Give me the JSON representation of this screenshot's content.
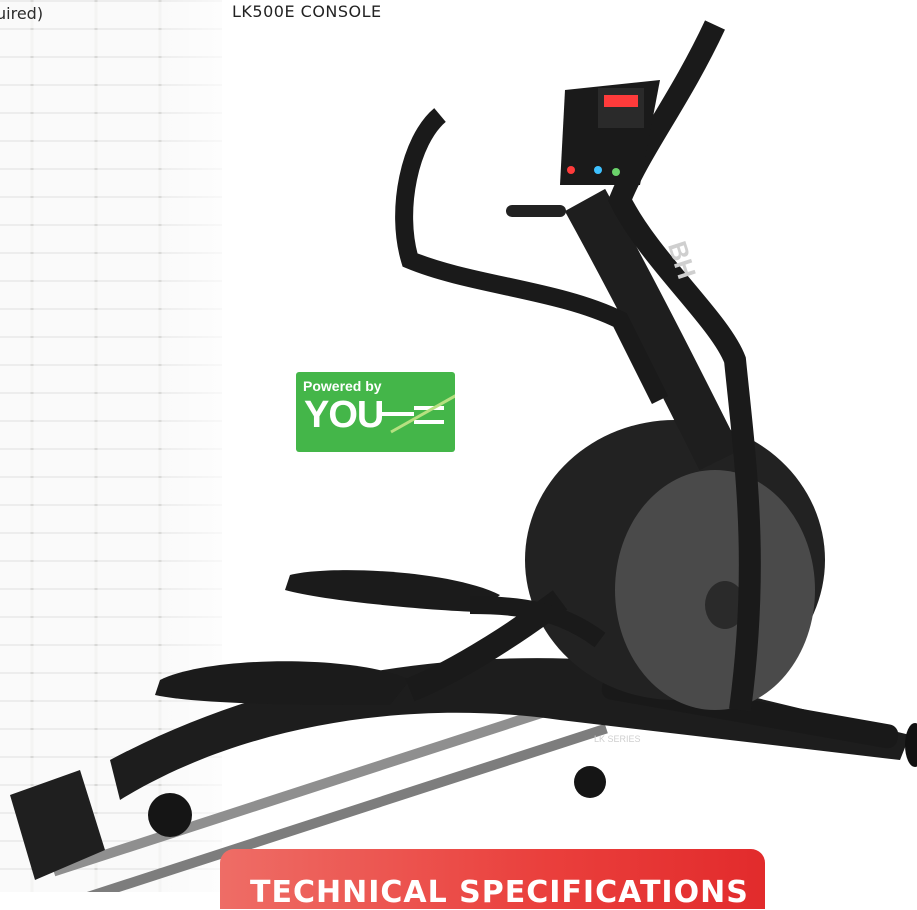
{
  "left_text": "uired)",
  "console_title": "LK500E CONSOLE",
  "badge": {
    "line1": "Powered by",
    "line2": "YOU"
  },
  "brand_mark": "BH",
  "frame_label": "LK SERIES",
  "specs_button": "TECHNICAL SPECIFICATIONS",
  "colors": {
    "badge_green": "#44b649",
    "specs_red": "#e22b2c",
    "machine_black": "#1a1a1a"
  }
}
